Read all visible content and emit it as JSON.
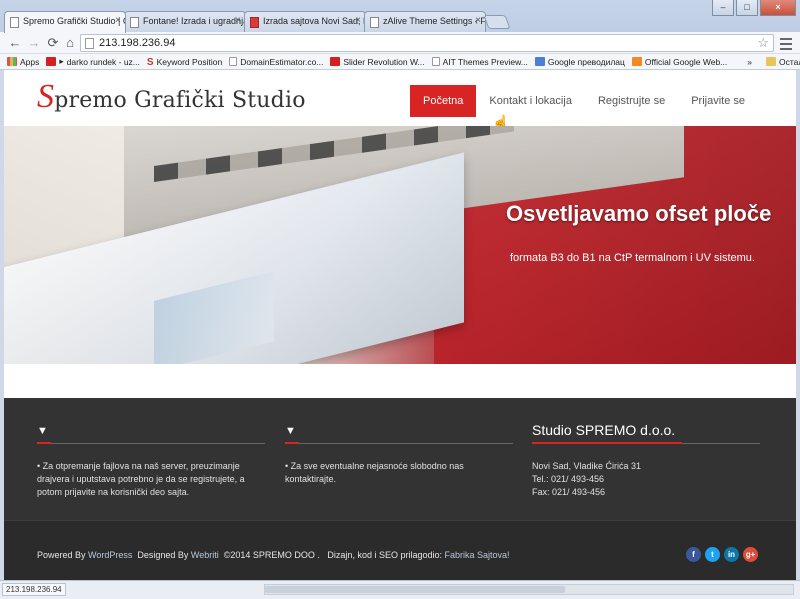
{
  "browser": {
    "tabs": [
      {
        "title": "Spremo Grafički Studio | C",
        "active": true,
        "icon": "page-icon"
      },
      {
        "title": "Fontane! Izrada i ugradnja",
        "active": false,
        "icon": "page-icon"
      },
      {
        "title": "Izrada sajtova Novi Sad, Bi",
        "active": false,
        "icon": "warning-icon"
      },
      {
        "title": "zAlive Theme Settings ‹ Fa",
        "active": false,
        "icon": "page-icon"
      }
    ],
    "url": "213.198.236.94",
    "bookmarks": [
      {
        "label": "Apps",
        "icon": "apps-icon",
        "color": "#d9534f"
      },
      {
        "label": "darko rundek - uz...",
        "icon": "youtube-icon",
        "color": "#d42020"
      },
      {
        "label": "Keyword Position",
        "icon": "s-icon",
        "color": "#c0392b"
      },
      {
        "label": "DomainEstimator.co...",
        "icon": "page-icon",
        "color": "#ffffff"
      },
      {
        "label": "Slider Revolution W...",
        "icon": "youtube-icon",
        "color": "#d42020"
      },
      {
        "label": "AIT Themes Preview...",
        "icon": "page-icon",
        "color": "#ffffff"
      },
      {
        "label": "Google преводилац",
        "icon": "translate-icon",
        "color": "#4a7fd6"
      },
      {
        "label": "Official Google Web...",
        "icon": "blogger-icon",
        "color": "#f08a24"
      }
    ],
    "bookmarks_more": "»",
    "other_bookmarks": "Остали обележивачи",
    "status_url": "213.198.236.94"
  },
  "site": {
    "logo_cap": "S",
    "logo_rest": "premo Grafički Studio",
    "nav": [
      {
        "label": "Početna",
        "active": true
      },
      {
        "label": "Kontakt i lokacija",
        "active": false
      },
      {
        "label": "Registrujte se",
        "active": false
      },
      {
        "label": "Prijavite se",
        "active": false
      }
    ],
    "hero": {
      "title": "Osvetljavamo ofset ploče",
      "subtitle": "formata B3 do B1 na CtP termalnom i UV sistemu."
    },
    "footer": {
      "col1_heading": "▼",
      "col1_text": "•  Za otpremanje fajlova na naš server, preuzimanje drajvera i uputstava potrebno je da se registrujete, a potom prijavite na korisnički deo sajta.",
      "col2_heading": "▼",
      "col2_text": "•  Za sve eventualne nejasnoće slobodno nas kontaktirajte.",
      "col3_title": "Studio SPREMO d.o.o.",
      "address": "Novi Sad, Vladike Ćirića 31",
      "tel": "Tel.: 021/ 493-456",
      "fax": "Fax: 021/ 493-456"
    },
    "credits": {
      "powered_prefix": "Powered By ",
      "powered_link": "WordPress",
      "designed_prefix": "  Designed By ",
      "designed_link": "Webriti",
      "copyright": "  ©2014 SPREMO DOO .   Dizajn, kod i SEO prilagodio: ",
      "agency_link": "Fabrika Sajtova!"
    },
    "social": [
      {
        "label": "f",
        "icon": "facebook-icon",
        "color": "#3b5998"
      },
      {
        "label": "t",
        "icon": "twitter-icon",
        "color": "#1da1f2"
      },
      {
        "label": "in",
        "icon": "linkedin-icon",
        "color": "#0e76a8"
      },
      {
        "label": "g+",
        "icon": "googleplus-icon",
        "color": "#dd4b39"
      }
    ]
  },
  "colors": {
    "accent_red": "#d82424",
    "footer_bg": "#333333"
  }
}
